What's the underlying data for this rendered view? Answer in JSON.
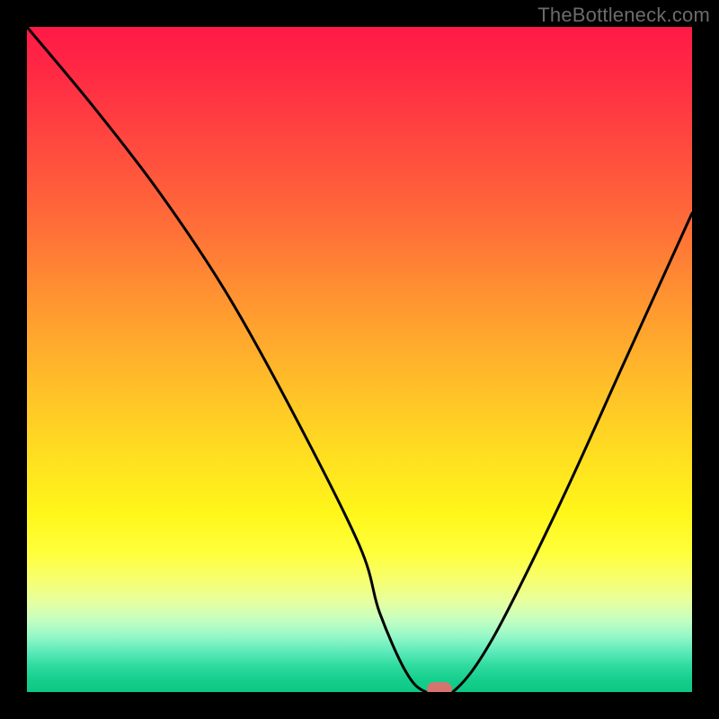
{
  "watermark": "TheBottleneck.com",
  "chart_data": {
    "type": "line",
    "title": "",
    "xlabel": "",
    "ylabel": "",
    "xlim": [
      0,
      100
    ],
    "ylim": [
      0,
      100
    ],
    "grid": false,
    "legend": false,
    "series": [
      {
        "name": "bottleneck-curve",
        "x": [
          0,
          10,
          20,
          30,
          40,
          50,
          53,
          57,
          60,
          64,
          70,
          80,
          90,
          100
        ],
        "y": [
          100,
          88,
          75,
          60,
          42,
          22,
          12,
          3,
          0,
          0,
          8,
          28,
          50,
          72
        ]
      }
    ],
    "marker": {
      "x": 62,
      "y": 0,
      "shape": "pill",
      "color": "#d5746e"
    },
    "background_gradient": {
      "stops": [
        {
          "pos": 0.0,
          "color": "#ff1947"
        },
        {
          "pos": 0.3,
          "color": "#ff6e38"
        },
        {
          "pos": 0.65,
          "color": "#ffe020"
        },
        {
          "pos": 0.8,
          "color": "#fbff50"
        },
        {
          "pos": 0.9,
          "color": "#b7ffc6"
        },
        {
          "pos": 1.0,
          "color": "#0cc884"
        }
      ]
    }
  }
}
